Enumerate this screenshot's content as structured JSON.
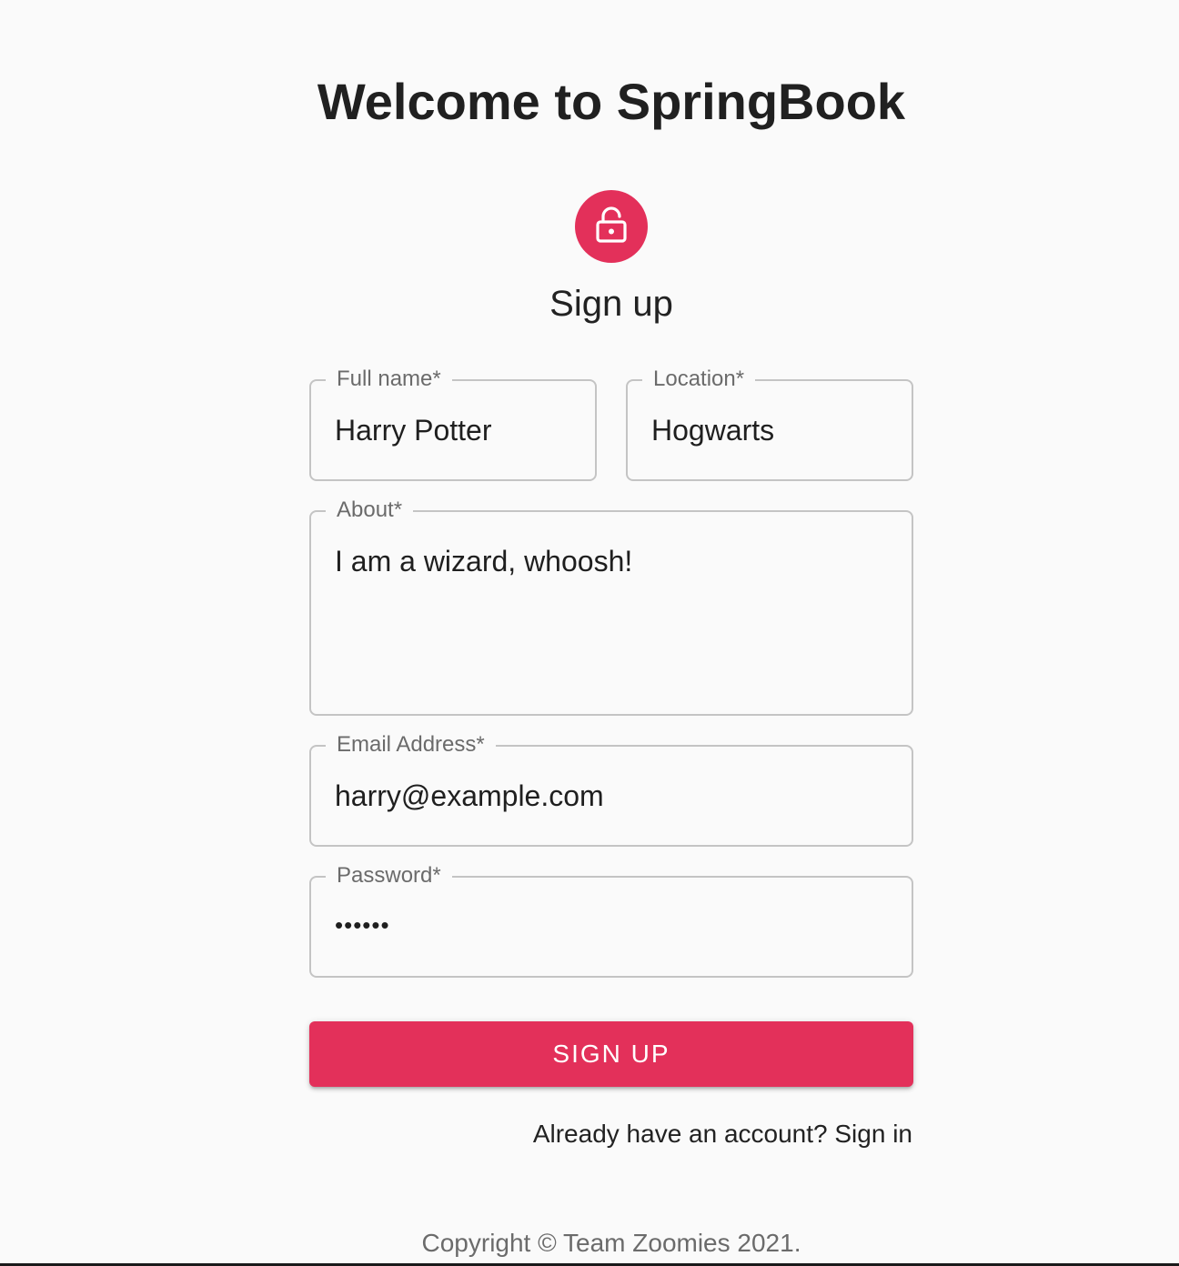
{
  "header": {
    "title": "Welcome to SpringBook"
  },
  "form": {
    "icon": "lock-open-icon",
    "title": "Sign up",
    "accent_color": "#e3305a",
    "fields": {
      "full_name": {
        "label": "Full name",
        "required_mark": "*",
        "value": "Harry Potter"
      },
      "location": {
        "label": "Location",
        "required_mark": "*",
        "value": "Hogwarts"
      },
      "about": {
        "label": "About",
        "required_mark": "*",
        "value": "I am a wizard, whoosh!"
      },
      "email": {
        "label": "Email Address",
        "required_mark": "*",
        "value": "harry@example.com"
      },
      "password": {
        "label": "Password",
        "required_mark": "*",
        "value": "••••••"
      }
    },
    "submit_label": "SIGN UP",
    "signin_link": "Already have an account? Sign in"
  },
  "footer": {
    "copyright": "Copyright © Team Zoomies 2021."
  }
}
